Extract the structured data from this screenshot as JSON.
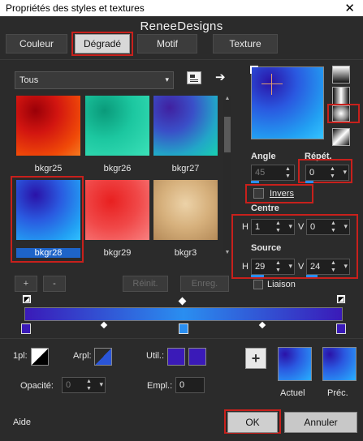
{
  "window": {
    "title": "Propriétés des styles et textures",
    "close_glyph": "✕"
  },
  "watermark": "ReneeDesigns",
  "tabs": [
    "Couleur",
    "Dégradé",
    "Motif",
    "Texture"
  ],
  "active_tab": "Dégradé",
  "filter": {
    "value": "Tous",
    "arrow": "▾"
  },
  "presets": [
    {
      "name": "bkgr25",
      "selected": false
    },
    {
      "name": "bkgr26",
      "selected": false
    },
    {
      "name": "bkgr27",
      "selected": false
    },
    {
      "name": "bkgr28",
      "selected": true
    },
    {
      "name": "bkgr29",
      "selected": false
    },
    {
      "name": "bkgr3",
      "selected": false
    }
  ],
  "buttons": {
    "add": "+",
    "remove": "-",
    "reset": "Réinit.",
    "save": "Enreg."
  },
  "angle": {
    "label": "Angle",
    "value": "45"
  },
  "repeat": {
    "label": "Répét.",
    "value": "0"
  },
  "invert": {
    "label": "Invers"
  },
  "center": {
    "label": "Centre",
    "h_label": "H",
    "h_value": "1",
    "v_label": "V",
    "v_value": "0"
  },
  "source": {
    "label": "Source",
    "h_label": "H",
    "h_value": "29",
    "v_label": "V",
    "v_value": "24"
  },
  "link": {
    "label": "Liaison"
  },
  "stop_controls": {
    "one_px_label": "1pl:",
    "arpl_label": "Arpl:",
    "util_label": "Util.:",
    "opacity_label": "Opacité:",
    "opacity_value": "0",
    "empl_label": "Empl.:",
    "empl_value": "0"
  },
  "previews": {
    "current": "Actuel",
    "previous": "Préc.",
    "plus": "+"
  },
  "footer": {
    "help": "Aide",
    "ok": "OK",
    "cancel": "Annuler"
  },
  "colors": {
    "accent_red": "#c8201c",
    "stop_left": "#3a1ab8",
    "stop_mid": "#2a8ef0",
    "stop_right": "#3a1ab8"
  }
}
